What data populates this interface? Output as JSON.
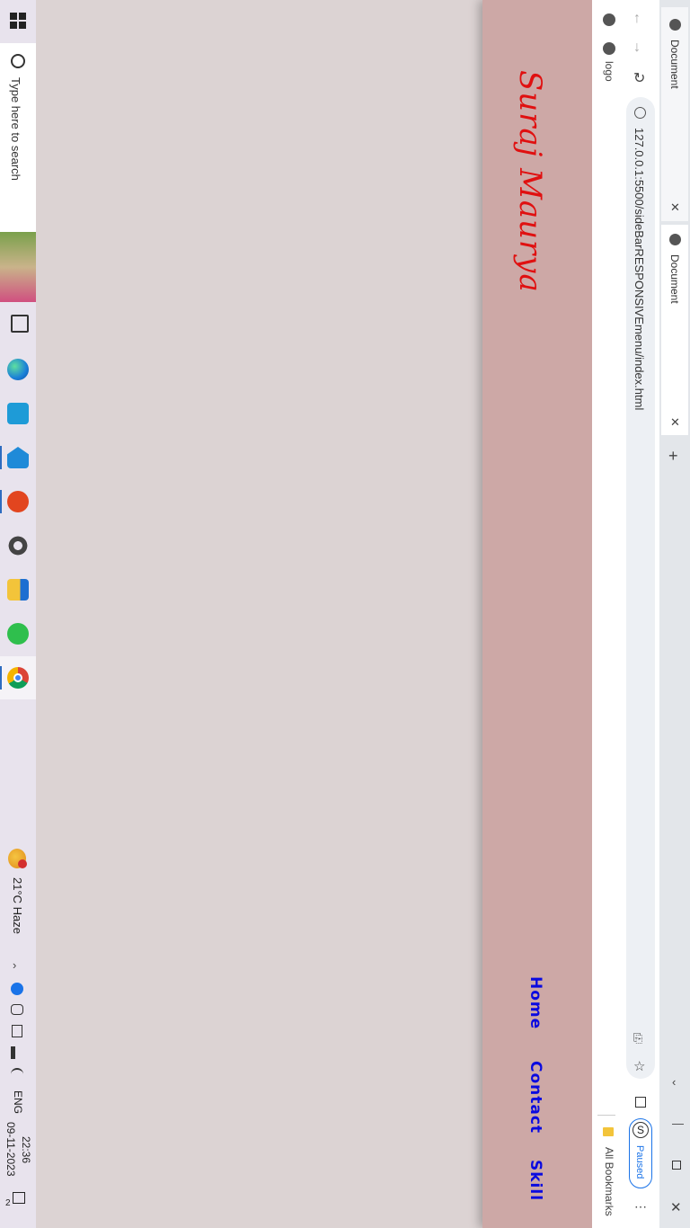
{
  "taskbar": {
    "search_placeholder": "Type here to search",
    "weather": "21°C  Haze",
    "language": "ENG",
    "time": "22:36",
    "date": "09-11-2023",
    "notification_count": "2"
  },
  "page": {
    "logo": "Suraj Maurya",
    "nav": [
      "Home",
      "Contact",
      "Skill"
    ]
  },
  "browser": {
    "tabs": [
      {
        "title": "Document"
      },
      {
        "title": "Document"
      }
    ],
    "new_tab": "+",
    "url": "127.0.0.1:5500/sideBarRESPONSIVEmenu/index.html",
    "profile_status": "Paused",
    "profile_initial": "S",
    "bookmark_logo": "logo",
    "all_bookmarks": "All Bookmarks"
  }
}
